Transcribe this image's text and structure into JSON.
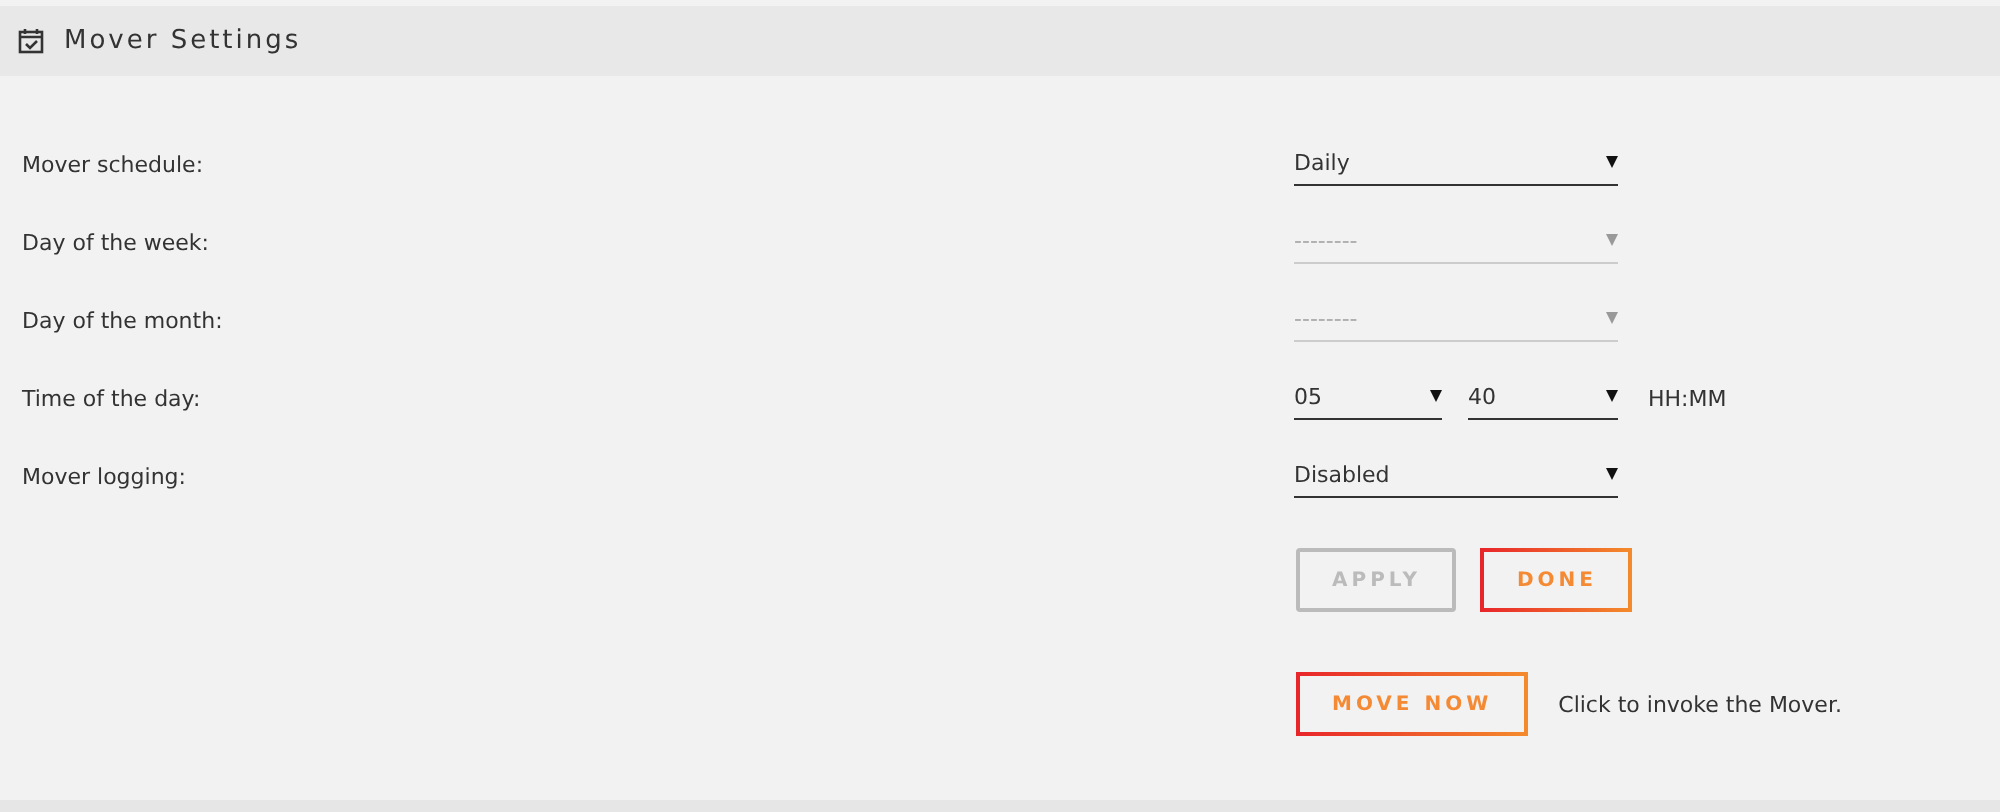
{
  "panel": {
    "title": "Mover Settings"
  },
  "fields": [
    {
      "kind": "select",
      "label": "Mover schedule:",
      "value": "Daily",
      "disabled": false
    },
    {
      "kind": "select",
      "label": "Day of the week:",
      "value": "--------",
      "disabled": true
    },
    {
      "kind": "select",
      "label": "Day of the month:",
      "value": "--------",
      "disabled": true
    },
    {
      "kind": "time",
      "label": "Time of the day:",
      "hours": "05",
      "minutes": "40",
      "format": "HH:MM",
      "disabled": false
    },
    {
      "kind": "select",
      "label": "Mover logging:",
      "value": "Disabled",
      "disabled": false
    }
  ],
  "buttons": [
    {
      "label": "APPLY",
      "disabled": true
    },
    {
      "label": "DONE",
      "disabled": false
    }
  ],
  "move": {
    "label": "MOVE NOW",
    "disabled": false,
    "note": "Click to invoke the Mover."
  }
}
